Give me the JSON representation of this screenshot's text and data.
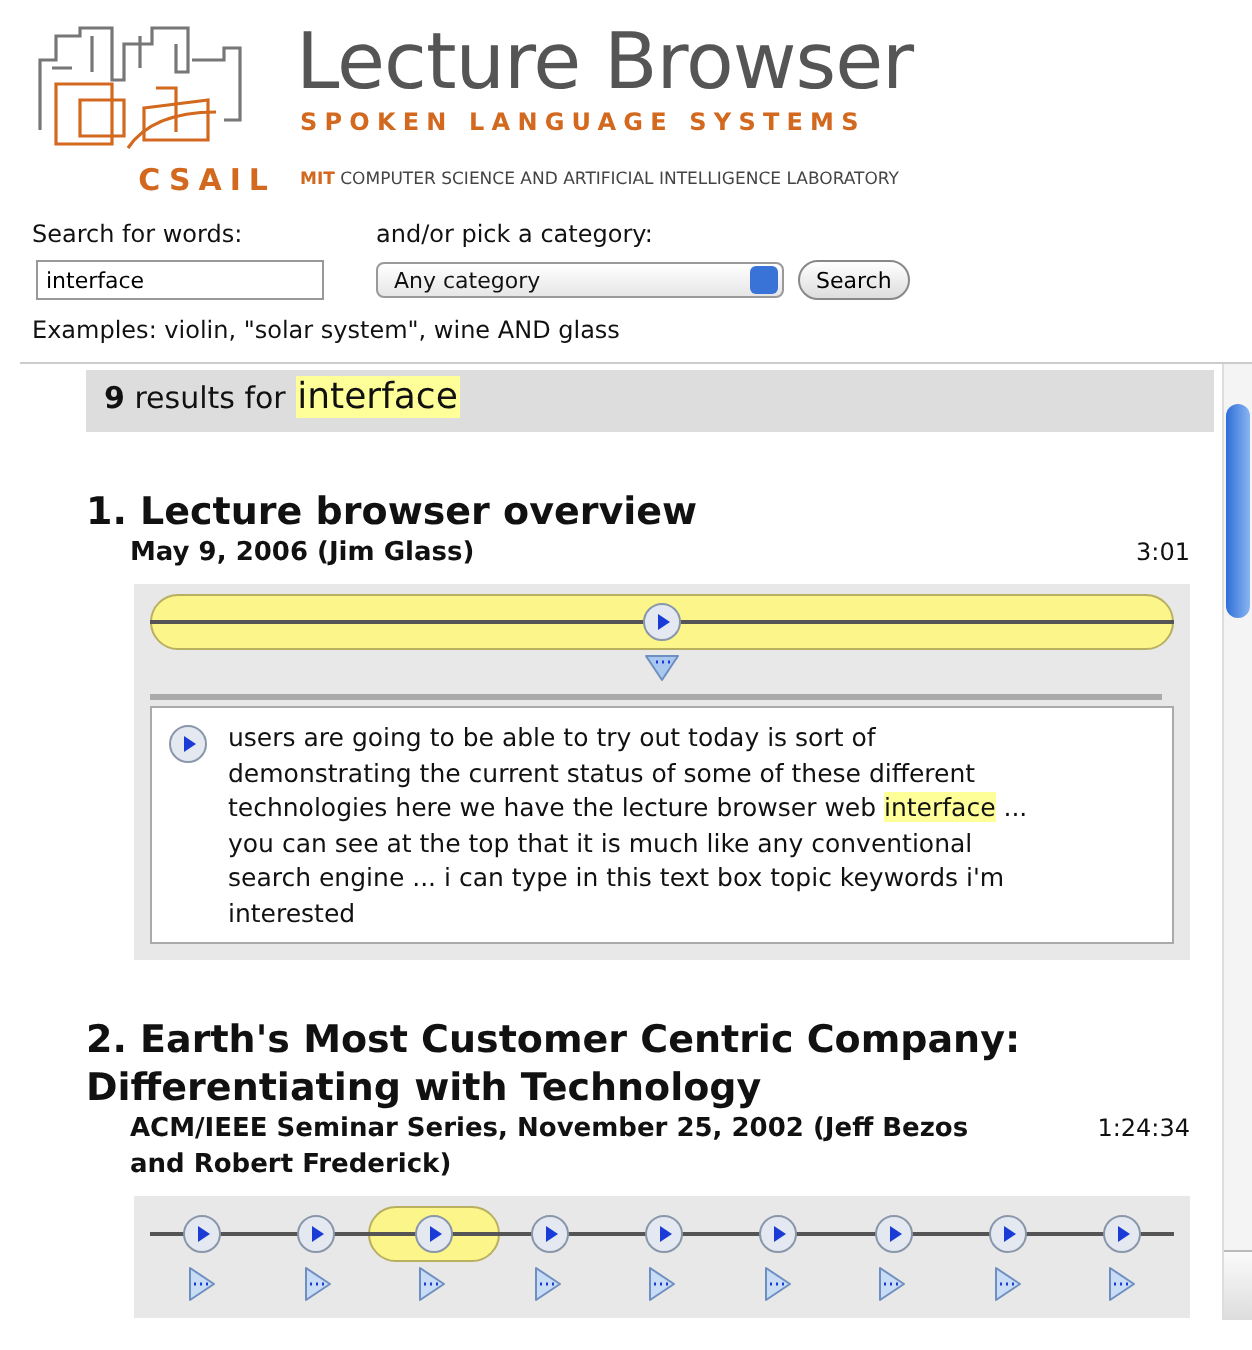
{
  "header": {
    "logo_text": "CSAIL",
    "title": "Lecture Browser",
    "subtitle": "SPOKEN LANGUAGE SYSTEMS",
    "lab_prefix": "MIT",
    "lab_name": "COMPUTER SCIENCE AND ARTIFICIAL INTELLIGENCE LABORATORY"
  },
  "search": {
    "words_label": "Search for words:",
    "category_label": "and/or pick a category:",
    "value": "interface",
    "category": "Any category",
    "button": "Search",
    "examples": "Examples: violin, \"solar system\", wine AND glass"
  },
  "results_header": {
    "count": "9",
    "label": "results for",
    "query": "interface"
  },
  "results": [
    {
      "title": "1. Lecture browser overview",
      "meta": "May 9, 2006 (Jim Glass)",
      "duration": "3:01",
      "segments": [
        {
          "selected": true
        }
      ],
      "snippet": [
        {
          "text": "users are going to be able to try out today is sort of demonstrating the current status of some of these different technologies here we have the lecture browser web ",
          "highlight": false
        },
        {
          "text": "interface",
          "highlight": true
        },
        {
          "text": " ... you can see at the top that it is much like any conventional search engine ... i can type in this text box topic keywords i'm interested",
          "highlight": false
        }
      ]
    },
    {
      "title": "2. Earth's Most Customer Centric Company: Differentiating with Technology",
      "meta": "ACM/IEEE Seminar Series, November 25, 2002 (Jeff Bezos and Robert Frederick)",
      "duration": "1:24:34",
      "segments": [
        {
          "selected": false
        },
        {
          "selected": false
        },
        {
          "selected": true
        },
        {
          "selected": false
        },
        {
          "selected": false
        },
        {
          "selected": false
        },
        {
          "selected": false
        },
        {
          "selected": false
        },
        {
          "selected": false
        }
      ]
    }
  ]
}
